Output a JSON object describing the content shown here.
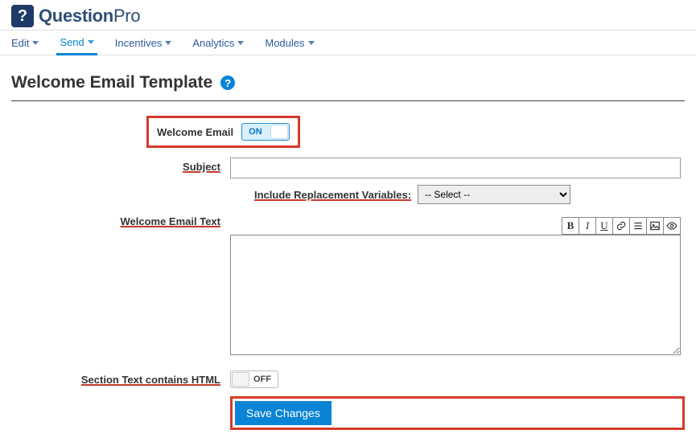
{
  "brand": {
    "mark": "?",
    "name_strong": "Question",
    "name_light": "Pro"
  },
  "nav": {
    "edit": "Edit",
    "send": "Send",
    "incentives": "Incentives",
    "analytics": "Analytics",
    "modules": "Modules"
  },
  "page": {
    "title": "Welcome Email Template",
    "help": "?"
  },
  "form": {
    "welcome_label": "Welcome Email",
    "toggle_on": "ON",
    "subject_label": "Subject",
    "subject_value": "",
    "replace_label": "Include Replacement Variables:",
    "select_placeholder": "-- Select --",
    "body_label": "Welcome Email Text",
    "body_value": "",
    "html_label": "Section Text contains HTML",
    "toggle_off": "OFF",
    "save": "Save Changes"
  },
  "toolbar": {
    "bold": "B",
    "italic": "I",
    "underline": "U"
  }
}
